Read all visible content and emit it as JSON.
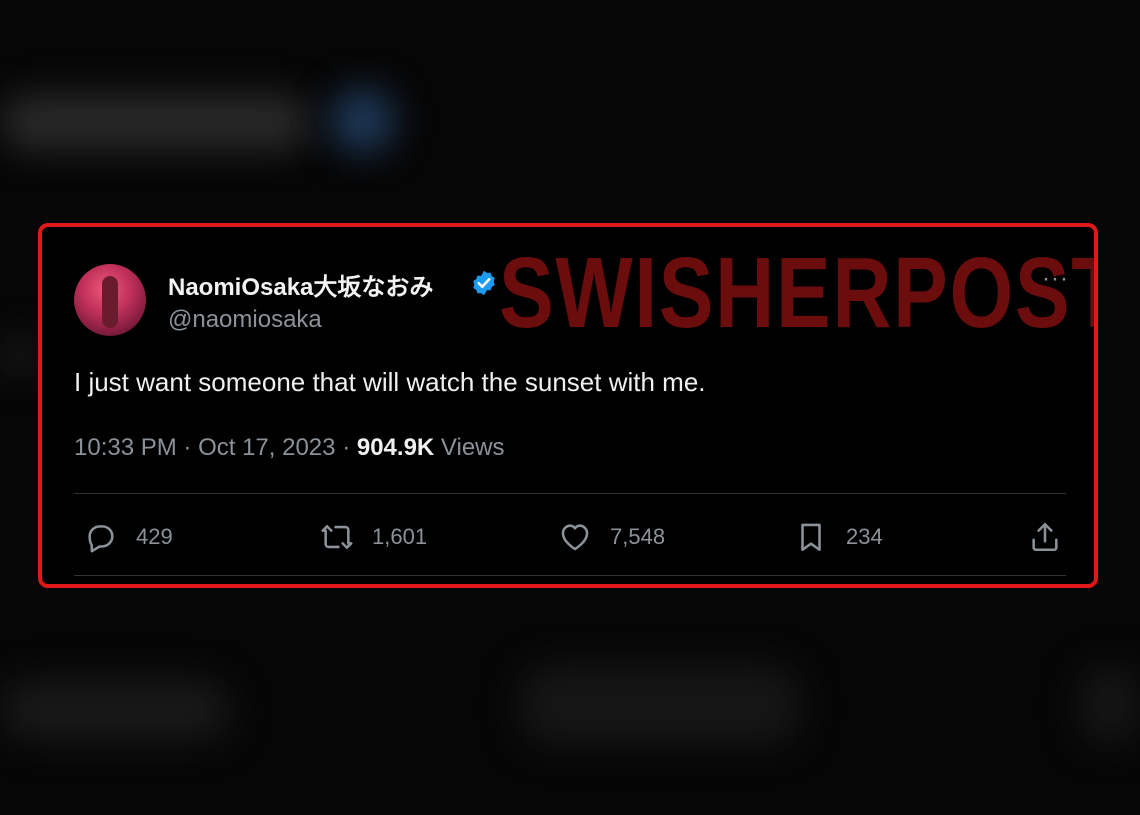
{
  "tweet": {
    "display_name": "NaomiOsaka大坂なおみ",
    "handle": "@naomiosaka",
    "text": "I just want someone that will watch the sunset with me.",
    "time": "10:33 PM",
    "separator": "·",
    "date": "Oct 17, 2023",
    "views_count": "904.9K",
    "views_label": "Views",
    "verified": true,
    "more_icon": "···"
  },
  "actions": {
    "replies": "429",
    "reposts": "1,601",
    "likes": "7,548",
    "bookmarks": "234"
  },
  "watermark": "SWISHERPOST",
  "icons": [
    "reply-icon",
    "repost-icon",
    "like-icon",
    "bookmark-icon",
    "share-icon",
    "verified-badge-icon",
    "more-icon"
  ],
  "colors": {
    "background": "#000000",
    "highlight_border": "#e01818",
    "watermark": "#6b0d0d",
    "verified": "#1d9bf0",
    "secondary_text": "#8b9299"
  }
}
